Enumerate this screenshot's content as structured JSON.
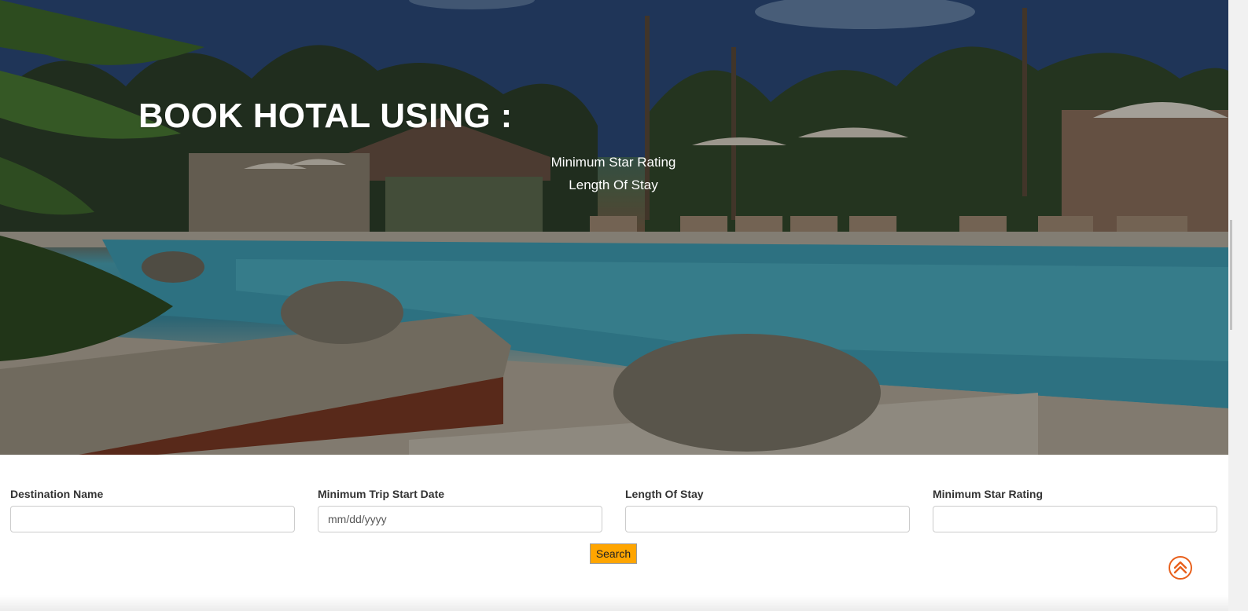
{
  "hero": {
    "title": "BOOK HOTAL USING :",
    "options": [
      "Minimum Star Rating",
      "Length Of Stay"
    ],
    "overlay_color": "#000000"
  },
  "form": {
    "fields": [
      {
        "label": "Destination Name",
        "value": "",
        "placeholder": "",
        "type": "text"
      },
      {
        "label": "Minimum Trip Start Date",
        "value": "",
        "placeholder": "mm/dd/yyyy",
        "type": "text"
      },
      {
        "label": "Length Of Stay",
        "value": "",
        "placeholder": "",
        "type": "text"
      },
      {
        "label": "Minimum Star Rating",
        "value": "",
        "placeholder": "",
        "type": "text"
      }
    ],
    "search_label": "Search",
    "search_color": "#ffa500"
  },
  "scroll_top": {
    "icon": "double-chevron-up-icon",
    "color": "#e8601c"
  }
}
